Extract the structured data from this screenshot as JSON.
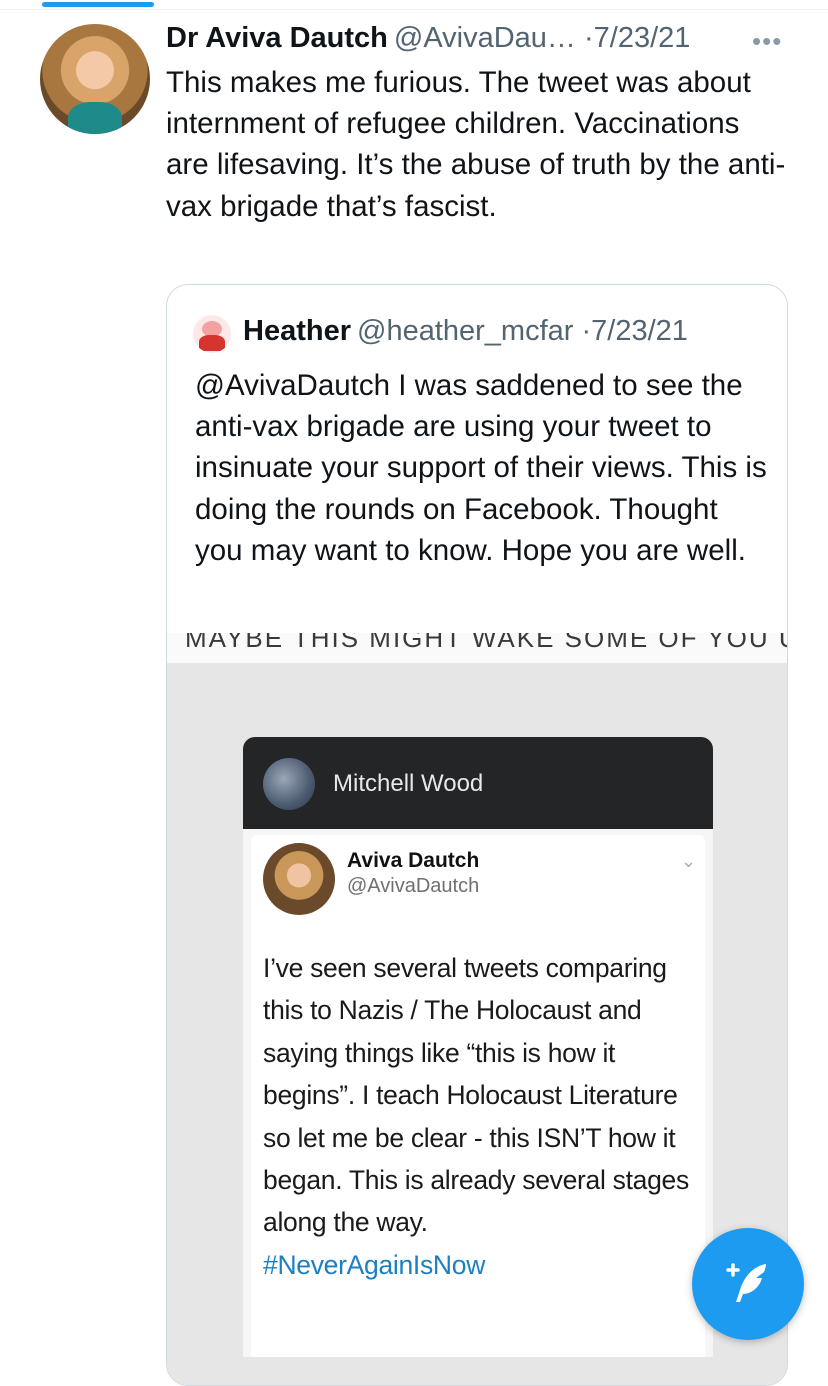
{
  "tweet": {
    "display_name": "Dr Aviva Dautch",
    "handle": "@AvivaDau…",
    "separator": "·",
    "date": "7/23/21",
    "more_icon": "more-dots-icon",
    "text": "This makes me furious. The tweet was about internment of refugee children. Vaccinations are lifesaving. It’s the abuse of truth by the anti-vax brigade that’s fascist."
  },
  "quote": {
    "display_name": "Heather",
    "handle": "@heather_mcfar",
    "separator": "·",
    "date": "7/23/21",
    "text": "@AvivaDautch I was saddened to see the anti-vax brigade are using your tweet to insinuate your support of their views. This is doing the rounds on Facebook. Thought you may want to know. Hope you are well.",
    "media": {
      "caption_cropped": "MAYBE THIS MIGHT WAKE SOME OF YOU UP!",
      "fb_post_author": "Mitchell Wood",
      "inner_tweet": {
        "name": "Aviva Dautch",
        "handle": "@AvivaDautch",
        "text": "I’ve seen several tweets comparing this to Nazis / The Holocaust and saying things like “this is how it begins”. I teach Holocaust Literature so let me be clear - this ISN’T how it began. This is already several stages along the way.",
        "hashtag": "#NeverAgainIsNow"
      }
    }
  },
  "fab": {
    "icon": "compose-tweet-icon",
    "color": "#1d9bf0"
  },
  "colors": {
    "accent": "#1d9bf0",
    "text": "#0f1419",
    "secondary": "#536471",
    "border": "#cfd9de"
  }
}
